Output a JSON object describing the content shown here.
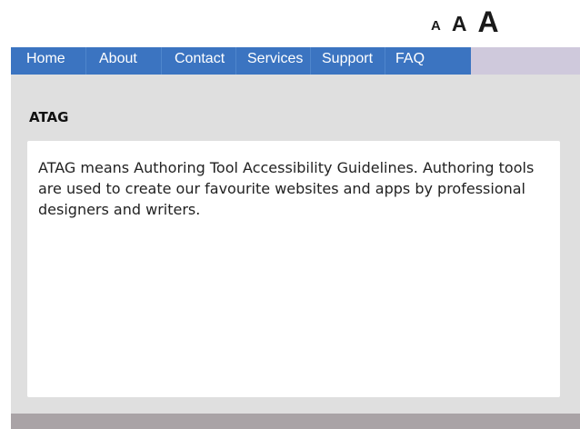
{
  "font_size_controls": {
    "small_label": "A",
    "medium_label": "A",
    "large_label": "A"
  },
  "nav": {
    "items": [
      {
        "label": "Home"
      },
      {
        "label": "About"
      },
      {
        "label": "Contact"
      },
      {
        "label": "Services"
      },
      {
        "label": "Support"
      },
      {
        "label": "FAQ"
      }
    ]
  },
  "section": {
    "heading": "ATAG",
    "body": "ATAG means Authoring Tool Accessibility Guidelines. Authoring tools are used to create our favourite websites and apps by professional designers and writers."
  },
  "colors": {
    "nav_background": "#3b74c1",
    "nav_spacer": "#cfc9dc",
    "main_background": "#dfdfdf",
    "card_background": "#ffffff",
    "footer": "#a9a3a6"
  }
}
